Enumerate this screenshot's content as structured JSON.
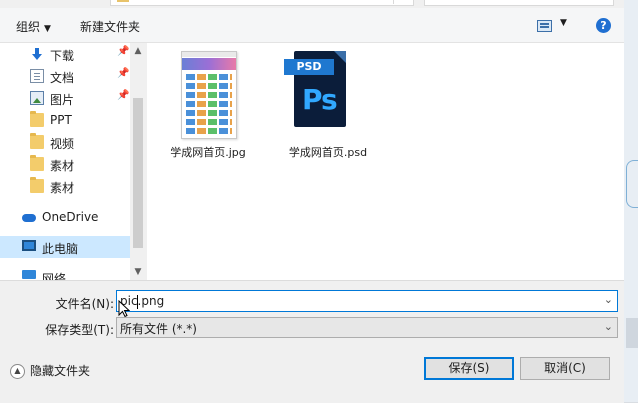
{
  "toolbar": {
    "organize_label": "组织",
    "new_folder_label": "新建文件夹",
    "help_label": "?"
  },
  "nav": {
    "items": [
      {
        "label": "下载",
        "icon": "download-icon",
        "pinned": true
      },
      {
        "label": "文档",
        "icon": "documents-icon",
        "pinned": true
      },
      {
        "label": "图片",
        "icon": "pictures-icon",
        "pinned": true
      },
      {
        "label": "PPT",
        "icon": "folder-icon",
        "pinned": false
      },
      {
        "label": "视频",
        "icon": "folder-icon",
        "pinned": false
      },
      {
        "label": "素材",
        "icon": "folder-icon",
        "pinned": false
      },
      {
        "label": "素材",
        "icon": "folder-icon",
        "pinned": false
      },
      {
        "label": "OneDrive",
        "icon": "onedrive-icon",
        "pinned": false
      },
      {
        "label": "此电脑",
        "icon": "this-pc-icon",
        "pinned": false,
        "selected": true
      },
      {
        "label": "网络",
        "icon": "network-icon",
        "pinned": false
      }
    ]
  },
  "files": [
    {
      "name": "学成网首页.jpg",
      "icon": "jpg-thumbnail"
    },
    {
      "name": "学成网首页.psd",
      "icon": "psd-file-icon",
      "badge": "PSD",
      "mark": "Ps"
    }
  ],
  "form": {
    "filename_label": "文件名(N):",
    "filename_value": "pic.png",
    "filetype_label": "保存类型(T):",
    "filetype_value": "所有文件 (*.*)"
  },
  "footer": {
    "hide_folders_label": "隐藏文件夹",
    "save_label": "保存(S)",
    "cancel_label": "取消(C)"
  },
  "colors": {
    "accent": "#0078d7",
    "selection": "#cce8ff",
    "help": "#1f6fd1",
    "psd_blue": "#31a8ff",
    "psd_dark": "#0b1d3a"
  }
}
